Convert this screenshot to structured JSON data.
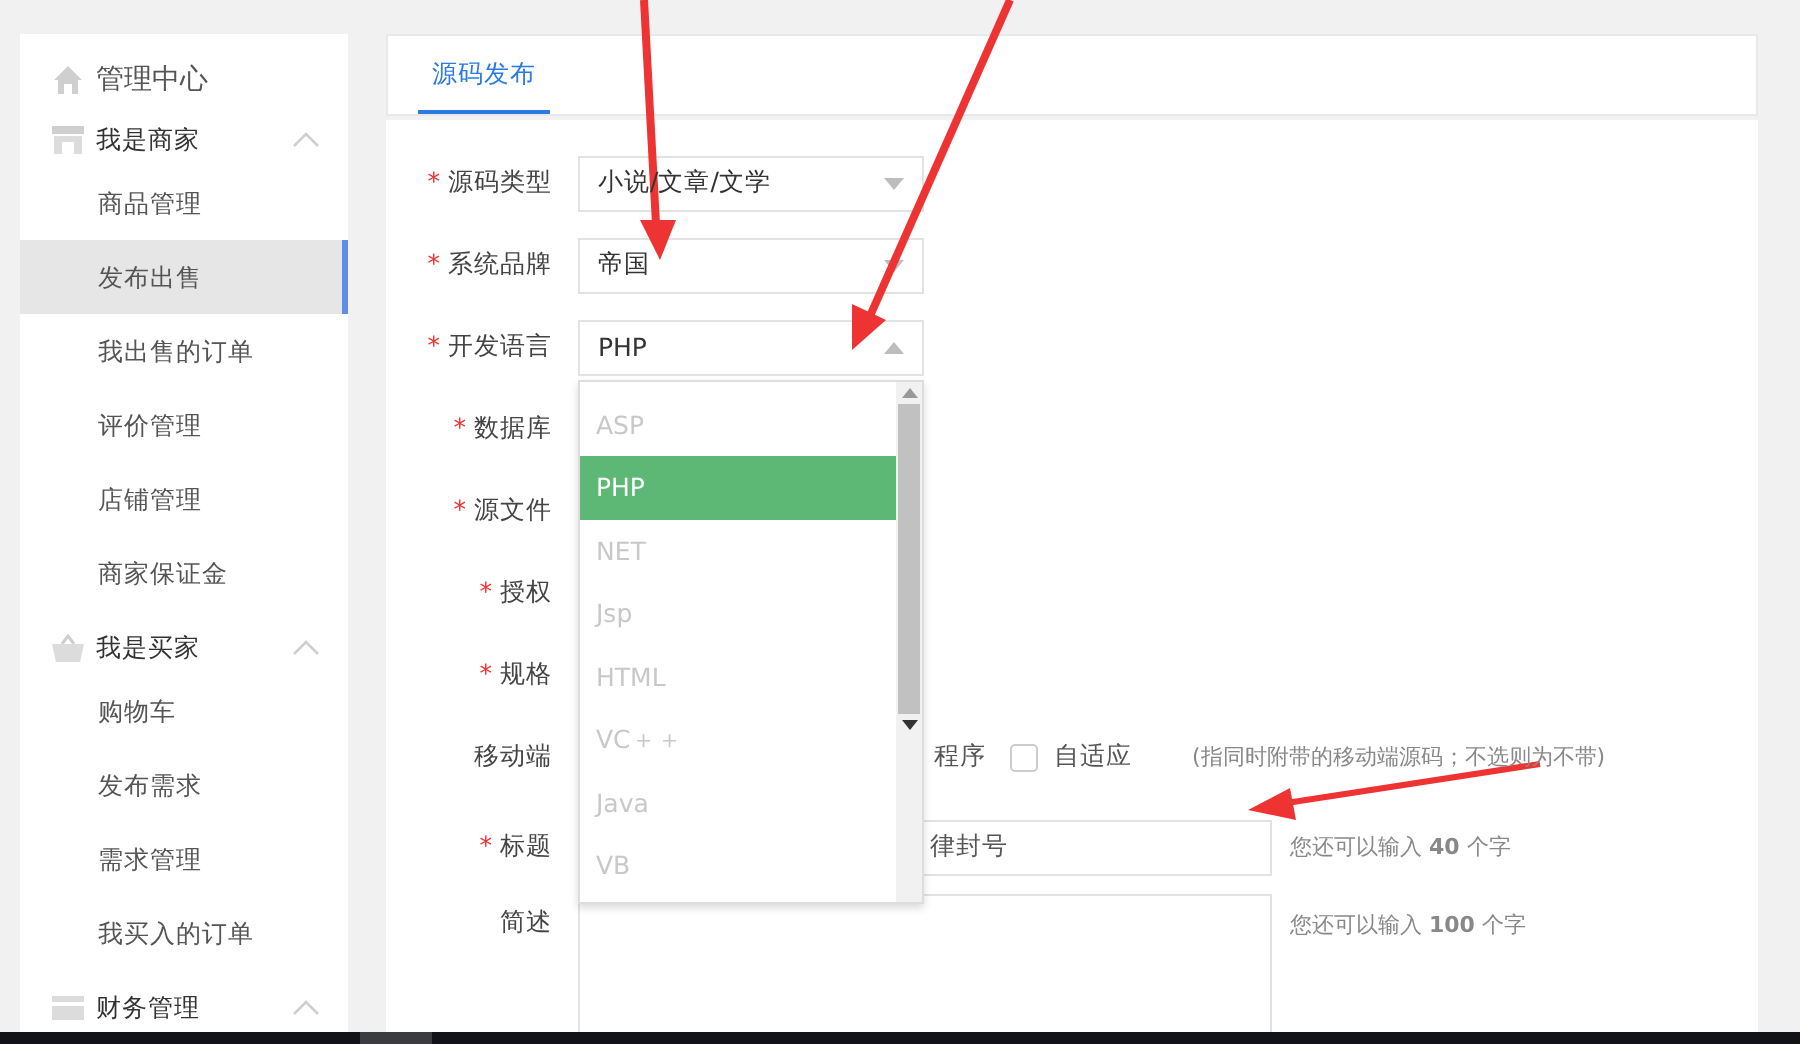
{
  "sidebar": {
    "title": "管理中心",
    "groups": [
      {
        "label": "我是商家",
        "expanded": true,
        "items": [
          {
            "label": "商品管理",
            "selected": false
          },
          {
            "label": "发布出售",
            "selected": true
          },
          {
            "label": "我出售的订单",
            "selected": false
          },
          {
            "label": "评价管理",
            "selected": false
          },
          {
            "label": "店铺管理",
            "selected": false
          },
          {
            "label": "商家保证金",
            "selected": false
          }
        ]
      },
      {
        "label": "我是买家",
        "expanded": true,
        "items": [
          {
            "label": "购物车",
            "selected": false
          },
          {
            "label": "发布需求",
            "selected": false
          },
          {
            "label": "需求管理",
            "selected": false
          },
          {
            "label": "我买入的订单",
            "selected": false
          }
        ]
      },
      {
        "label": "财务管理",
        "expanded": true
      }
    ]
  },
  "tabs": [
    {
      "label": "源码发布",
      "selected": true
    }
  ],
  "form": {
    "rows": [
      {
        "mark": "*",
        "label": "源码类型",
        "kind": "select",
        "value": "小说/文章/文学",
        "open": false
      },
      {
        "mark": "*",
        "label": "系统品牌",
        "kind": "select",
        "value": "帝国",
        "open": false
      },
      {
        "mark": "*",
        "label": "开发语言",
        "kind": "select",
        "value": "PHP",
        "open": true
      },
      {
        "mark": "*",
        "label": "数据库",
        "kind": "covered"
      },
      {
        "mark": "*",
        "label": "源文件",
        "kind": "covered"
      },
      {
        "mark": "*",
        "label": "授权",
        "kind": "covered"
      },
      {
        "mark": "*",
        "label": "规格",
        "kind": "covered"
      },
      {
        "label": "移动端",
        "kind": "checks",
        "options": [
          {
            "label": "程序",
            "kind": "partial"
          },
          {
            "label": "自适应",
            "kind": "full",
            "checked": false
          }
        ],
        "hint": "(指同时附带的移动端源码；不选则为不带)"
      },
      {
        "mark": "*",
        "label": "标题",
        "kind": "text",
        "value": "律封号",
        "hint": "您还可以输入 **40** 个字"
      },
      {
        "label": "简述",
        "kind": "textarea",
        "hint": "您还可以输入 **100** 个字"
      }
    ]
  },
  "dropdown": {
    "options": [
      {
        "label": "ASP",
        "selected": false
      },
      {
        "label": "PHP",
        "selected": true
      },
      {
        "label": "NET",
        "selected": false
      },
      {
        "label": "Jsp",
        "selected": false
      },
      {
        "label": "HTML",
        "selected": false
      },
      {
        "label": "VC＋＋",
        "selected": false
      },
      {
        "label": "Java",
        "selected": false
      },
      {
        "label": "VB",
        "selected": false
      }
    ]
  }
}
